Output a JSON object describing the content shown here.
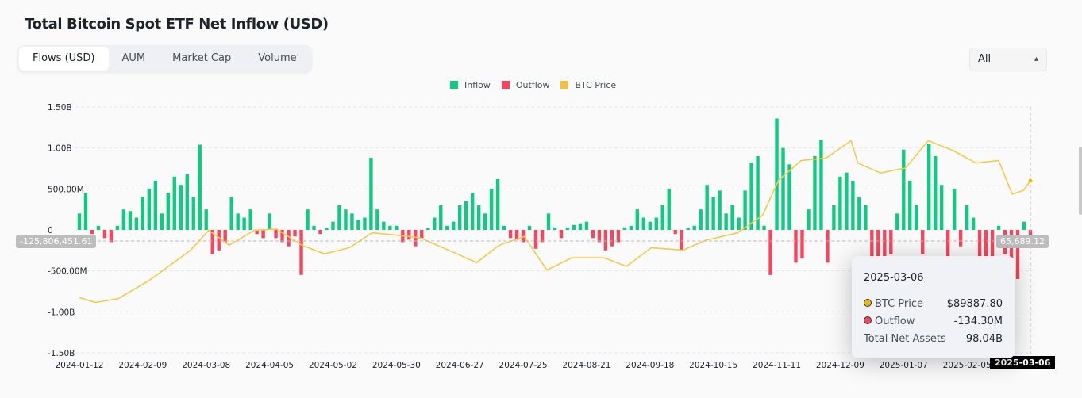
{
  "title": "Total Bitcoin Spot ETF Net Inflow (USD)",
  "tabs": [
    {
      "label": "Flows (USD)",
      "active": true
    },
    {
      "label": "AUM"
    },
    {
      "label": "Market Cap"
    },
    {
      "label": "Volume"
    }
  ],
  "range_select": {
    "value": "All",
    "icon": "chevron-updown-icon"
  },
  "colors": {
    "inflow": "#0ecb81",
    "outflow": "#f6465d",
    "btc_price": "#f0b90b"
  },
  "crosshair": {
    "left_value": "-125,806,451.61",
    "right_value": "65,689.12",
    "x_value": "2025-03-06"
  },
  "tooltip": {
    "date": "2025-03-06",
    "rows": [
      {
        "label": "BTC Price",
        "value": "$89887.80",
        "color": "#f0b90b"
      },
      {
        "label": "Outflow",
        "value": "-134.30M",
        "color": "#f6465d"
      }
    ],
    "total_label": "Total Net Assets",
    "total_value": "98.04B"
  },
  "chart_data": {
    "type": "bar+line",
    "title": "Total Bitcoin Spot ETF Net Inflow (USD)",
    "legend": [
      "Inflow",
      "Outflow",
      "BTC Price"
    ],
    "legend_position": "top-center",
    "grid": true,
    "y_ticks": [
      "1.50B",
      "1.00B",
      "500.00M",
      "0",
      "-500.00M",
      "-1.00B",
      "-1.50B"
    ],
    "ylim_usd": [
      -1500000000,
      1500000000
    ],
    "x_ticks": [
      "2024-01-12",
      "2024-02-09",
      "2024-03-08",
      "2024-04-05",
      "2024-05-02",
      "2024-05-30",
      "2024-06-27",
      "2024-07-25",
      "2024-08-21",
      "2024-09-18",
      "2024-10-15",
      "2024-11-11",
      "2024-12-09",
      "2025-01-07",
      "2025-02-05",
      "2025-03-06"
    ],
    "x_range": [
      "2024-01-12",
      "2025-03-06"
    ],
    "flows_musd": [
      200,
      450,
      -50,
      50,
      -100,
      -150,
      50,
      250,
      230,
      150,
      400,
      500,
      600,
      200,
      450,
      650,
      550,
      680,
      400,
      1040,
      250,
      -300,
      -250,
      -150,
      400,
      200,
      150,
      250,
      -50,
      -100,
      200,
      -100,
      -150,
      -200,
      -80,
      -550,
      250,
      50,
      -50,
      20,
      100,
      300,
      250,
      200,
      120,
      150,
      880,
      250,
      100,
      50,
      50,
      -150,
      -120,
      -200,
      -100,
      20,
      150,
      300,
      50,
      100,
      300,
      350,
      450,
      300,
      200,
      500,
      620,
      50,
      -100,
      -120,
      -150,
      50,
      -230,
      -150,
      200,
      30,
      -100,
      30,
      60,
      80,
      100,
      -100,
      -150,
      -250,
      -200,
      -150,
      30,
      50,
      250,
      150,
      100,
      150,
      300,
      500,
      -50,
      -250,
      20,
      50,
      250,
      550,
      400,
      480,
      200,
      300,
      150,
      480,
      820,
      900,
      50,
      -550,
      1360,
      1000,
      800,
      -400,
      -350,
      250,
      900,
      1100,
      -400,
      300,
      650,
      700,
      600,
      400,
      300,
      -400,
      -650,
      -350,
      -300,
      200,
      980,
      600,
      300,
      -300,
      1050,
      900,
      550,
      -350,
      500,
      -200,
      300,
      150,
      -400,
      -500,
      -600,
      50,
      -300,
      -400,
      -600,
      100,
      -134.3
    ],
    "btc_price": [
      [
        "2024-01-12",
        43000
      ],
      [
        "2024-01-19",
        41000
      ],
      [
        "2024-01-29",
        42500
      ],
      [
        "2024-02-12",
        50000
      ],
      [
        "2024-03-01",
        62000
      ],
      [
        "2024-03-09",
        70000
      ],
      [
        "2024-03-18",
        64000
      ],
      [
        "2024-03-29",
        70000
      ],
      [
        "2024-04-08",
        70500
      ],
      [
        "2024-04-19",
        64000
      ],
      [
        "2024-04-29",
        60500
      ],
      [
        "2024-05-10",
        63000
      ],
      [
        "2024-05-20",
        69000
      ],
      [
        "2024-05-31",
        68000
      ],
      [
        "2024-06-10",
        67000
      ],
      [
        "2024-06-24",
        61500
      ],
      [
        "2024-07-05",
        57000
      ],
      [
        "2024-07-15",
        64000
      ],
      [
        "2024-07-26",
        67500
      ],
      [
        "2024-08-05",
        54000
      ],
      [
        "2024-08-16",
        59000
      ],
      [
        "2024-08-30",
        59000
      ],
      [
        "2024-09-09",
        55500
      ],
      [
        "2024-09-20",
        63000
      ],
      [
        "2024-10-04",
        62000
      ],
      [
        "2024-10-14",
        66000
      ],
      [
        "2024-10-28",
        69000
      ],
      [
        "2024-11-08",
        76000
      ],
      [
        "2024-11-15",
        90000
      ],
      [
        "2024-11-25",
        98000
      ],
      [
        "2024-12-06",
        99000
      ],
      [
        "2024-12-20",
        97000
      ],
      [
        "2024-12-17",
        106000
      ],
      [
        "2024-12-30",
        93000
      ],
      [
        "2025-01-10",
        95000
      ],
      [
        "2025-01-20",
        106000
      ],
      [
        "2025-01-31",
        102000
      ],
      [
        "2025-02-10",
        97000
      ],
      [
        "2025-02-20",
        98000
      ],
      [
        "2025-02-26",
        84500
      ],
      [
        "2025-03-03",
        86000
      ],
      [
        "2025-03-06",
        89887.8
      ]
    ]
  }
}
